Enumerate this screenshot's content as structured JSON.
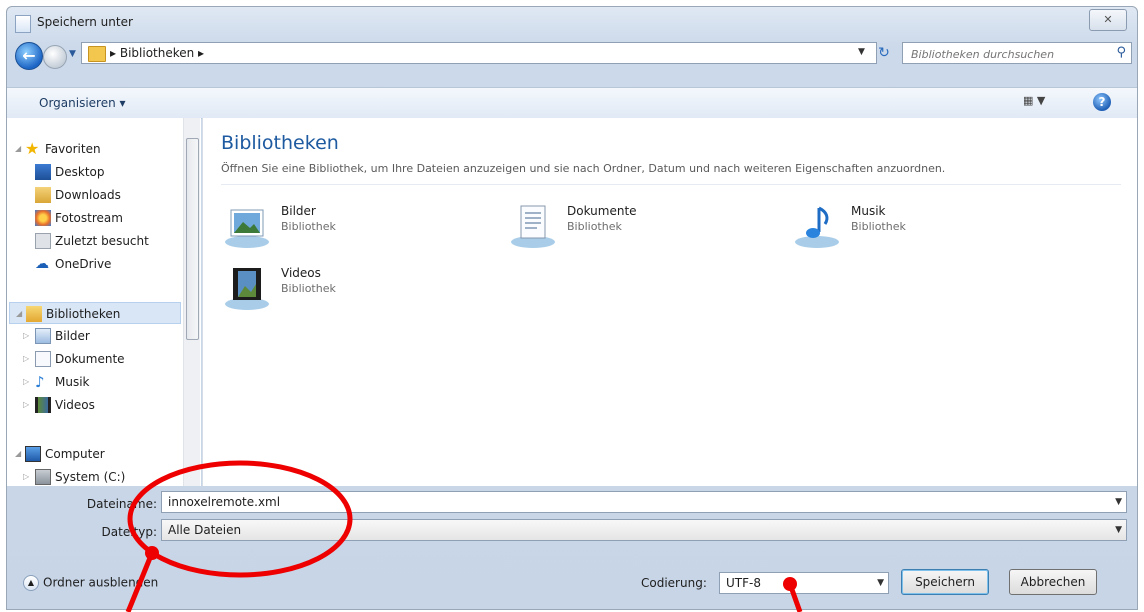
{
  "window": {
    "title": "Speichern unter",
    "close_label": "✕"
  },
  "address": {
    "breadcrumb": "▸ Bibliotheken ▸",
    "search_placeholder": "Bibliotheken durchsuchen"
  },
  "toolbar": {
    "organize_label": "Organisieren ▾",
    "help_label": "?"
  },
  "nav": {
    "favorites": {
      "label": "Favoriten",
      "items": [
        "Desktop",
        "Downloads",
        "Fotostream",
        "Zuletzt besucht",
        "OneDrive"
      ]
    },
    "libraries": {
      "label": "Bibliotheken",
      "items": [
        "Bilder",
        "Dokumente",
        "Musik",
        "Videos"
      ]
    },
    "computer": {
      "label": "Computer",
      "items": [
        "System (C:)"
      ]
    }
  },
  "content": {
    "title": "Bibliotheken",
    "description": "Öffnen Sie eine Bibliothek, um Ihre Dateien anzuzeigen und sie nach Ordner, Datum und nach weiteren Eigenschaften anzuordnen.",
    "libraries": [
      {
        "name": "Bilder",
        "type": "Bibliothek"
      },
      {
        "name": "Dokumente",
        "type": "Bibliothek"
      },
      {
        "name": "Musik",
        "type": "Bibliothek"
      },
      {
        "name": "Videos",
        "type": "Bibliothek"
      }
    ]
  },
  "form": {
    "filename_label": "Dateiname:",
    "filename_value": "innoxelremote.xml",
    "filetype_label": "Dateityp:",
    "filetype_value": "Alle Dateien"
  },
  "bottom": {
    "hide_folders_label": "Ordner ausblenden",
    "encoding_label": "Codierung:",
    "encoding_value": "UTF-8",
    "save_label": "Speichern",
    "cancel_label": "Abbrechen"
  },
  "annotation_color": "#ee0000"
}
